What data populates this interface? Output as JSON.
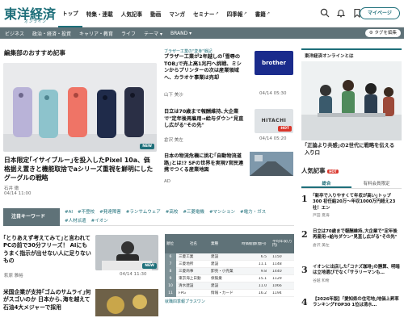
{
  "header": {
    "logo": "東洋経済",
    "logo_sub": "オンライン",
    "nav": [
      {
        "label": "トップ"
      },
      {
        "label": "特集・連載"
      },
      {
        "label": "人気記事"
      },
      {
        "label": "動画"
      },
      {
        "label": "マンガ"
      },
      {
        "label": "セミナー"
      },
      {
        "label": "四季報"
      },
      {
        "label": "書籍"
      }
    ],
    "mypage_label": "マイページ"
  },
  "category_bar": {
    "items": [
      "ビジネス",
      "政治・経済・投資",
      "キャリア・教育",
      "ライフ",
      "テーマ ▾",
      "BRAND ▾"
    ],
    "tag_button": "タグを編集"
  },
  "main": {
    "section_title": "編集部のおすすめ記事",
    "hero": {
      "badge": "NEW",
      "title": "日本限定｢イサイブルー｣を投入したPixel 10a、価格据え置きと機能取捨でaシリーズ重視を鮮明にしたグーグルの戦略",
      "author": "石井 徹",
      "date": "04/14 11:00"
    },
    "side_cards": [
      {
        "category": "ブラザー工業の\"変身\"戦記",
        "title": "ブラザー工業が2年越しの｢雪辱のTOB｣で売上高1兆円へ挑戦、ミシンからプリンターの次は産業領域へ、カラオケ事業は売却",
        "author": "山下 美沙",
        "date": "04/14 05:30",
        "logo": "brother"
      },
      {
        "category": "",
        "title": "日立は70歳まで報酬維持､大企業で\"定年後再雇用→給与ダウン\"見直し広がる\"その先\"",
        "author": "倉沢 美左",
        "date": "04/14 05:20",
        "logo": "HITACHI",
        "badge": "HOT"
      },
      {
        "category": "",
        "title": "日本の物流危機に挑む｢自動物流道路｣とは!? SFの世界を実現?官民連携でつくる産業地図",
        "author": "AD",
        "date": "",
        "logo": ""
      }
    ],
    "keywords": {
      "label": "注目キーワード",
      "tags": [
        "#AI",
        "#不登校",
        "#発達障害",
        "#ランサムウェア",
        "#高校",
        "#三菱電機",
        "#マンション",
        "#電力・ガス",
        "#人材派遣",
        "#イオン"
      ]
    },
    "bottom_article": {
      "title": "｢とりあえず考えてみて｣と言われてPCの前で30分フリーズ！ AIにもうまく指示が出せない人に足りないもの",
      "author": "萩原 雅裕",
      "date": "04/14 11:30",
      "badge": "NEW"
    },
    "bottom_article2": {
      "title": "米国企業が支持｢ゴムのサムライ｣何がスゴいのか 日本から､海を越えて石油4大メジャーで採用"
    },
    "table": {
      "headers": [
        "順位",
        "社名",
        "業種",
        "時価総額(億円)",
        "平均年収(万円)"
      ],
      "rows": [
        [
          "6",
          "三菱工業",
          "建設",
          "6.5",
          "1150"
        ],
        [
          "7",
          "三菱地所",
          "建設",
          "11.1",
          "1148"
        ],
        [
          "8",
          "三菱商事",
          "卸売・小売業",
          "9.8",
          "1440"
        ],
        [
          "9",
          "東京海上日動",
          "保険業",
          "15.1",
          "1129"
        ],
        [
          "10",
          "清水建設",
          "建設",
          "11.0",
          "1066"
        ],
        [
          "11",
          "FPG",
          "情報・カード",
          "16.2",
          "1194"
        ]
      ],
      "footer": "就職四季報プラスワン"
    }
  },
  "sidebar": {
    "ad_header": "東洋経済オンラインとは",
    "ad_title": "｢正論より共感｣の2世代に戦略を伝える入り口",
    "ranking_title": "人気記事",
    "ranking_badge": "HOT",
    "tabs": [
      "総合",
      "有料会員限定"
    ],
    "ranking": [
      {
        "num": "1",
        "title": "｢新卒で入りやすくて年収が高い｣トップ300 初任給20万～年収1000万円超え23社！エン",
        "author": "戸田 夏海"
      },
      {
        "num": "2",
        "title": "日立は70歳まで報酬維持､大企業で\"定年後再雇用→給与ダウン\"見直し広がる\"その先\"",
        "author": "倉沢 美左"
      },
      {
        "num": "3",
        "title": "イオンに出店した｢コナズ珈琲｣の勝算、明暗は立地選びでなく｢サラリーマンも…",
        "author": "谷越 和希"
      },
      {
        "num": "4",
        "title": "【2026年版】｢愛知県の住宅地｣地価上昇率ランキングTOP30 1位は清水…",
        "author": ""
      }
    ]
  }
}
